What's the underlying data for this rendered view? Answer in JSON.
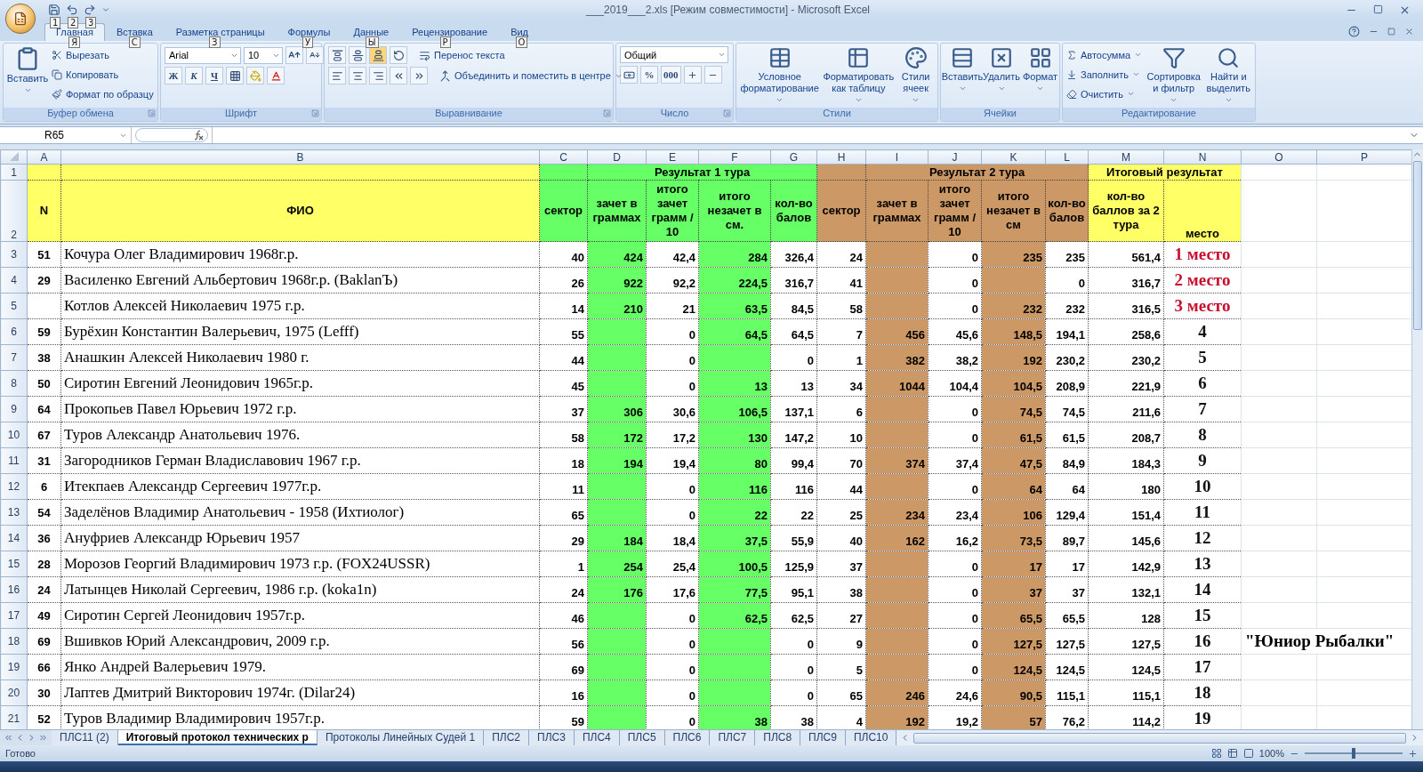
{
  "window": {
    "title": "___2019___2.xls  [Режим совместимости] - Microsoft Excel",
    "quick_access_keytips": [
      "1",
      "2",
      "3"
    ]
  },
  "ribbon": {
    "tabs": [
      {
        "label": "Главная",
        "keytip": "Я",
        "selected": true
      },
      {
        "label": "Вставка",
        "keytip": "С",
        "selected": false
      },
      {
        "label": "Разметка страницы",
        "keytip": "З",
        "selected": false
      },
      {
        "label": "Формулы",
        "keytip": "У",
        "selected": false
      },
      {
        "label": "Данные",
        "keytip": "Ы",
        "selected": false
      },
      {
        "label": "Рецензирование",
        "keytip": "Р",
        "selected": false
      },
      {
        "label": "Вид",
        "keytip": "О",
        "selected": false
      }
    ],
    "clipboard": {
      "title": "Буфер обмена",
      "paste": "Вставить",
      "items": [
        "Вырезать",
        "Копировать",
        "Формат по образцу"
      ]
    },
    "font": {
      "title": "Шрифт",
      "name": "Arial",
      "size": "10",
      "styles": [
        "Ж",
        "К",
        "Ч"
      ]
    },
    "alignment": {
      "title": "Выравнивание",
      "vertical_align": [
        {
          "selected": false
        },
        {
          "selected": false
        },
        {
          "selected": true
        }
      ],
      "wrap": "Перенос текста",
      "merge": "Объединить и поместить в центре"
    },
    "number": {
      "title": "Число",
      "format": "Общий",
      "percent": "%",
      "thousands": "000"
    },
    "styles": {
      "title": "Стили",
      "buttons": [
        "Условное форматирование",
        "Форматировать как таблицу",
        "Стили ячеек"
      ]
    },
    "cells": {
      "title": "Ячейки",
      "buttons": [
        "Вставить",
        "Удалить",
        "Формат"
      ]
    },
    "editing": {
      "title": "Редактирование",
      "items": [
        "Автосумма",
        "Заполнить",
        "Очистить"
      ],
      "buttons": [
        "Сортировка и фильтр",
        "Найти и выделить"
      ]
    }
  },
  "formula_bar": {
    "name_box": "R65"
  },
  "sheet": {
    "column_letters": [
      "A",
      "B",
      "C",
      "D",
      "E",
      "F",
      "G",
      "H",
      "I",
      "J",
      "K",
      "L",
      "M",
      "N",
      "O",
      "P"
    ],
    "groups": [
      {
        "label": "Результат 1 тура",
        "color": "#66ff66"
      },
      {
        "label": "Результат 2 тура",
        "color": "#cc9966"
      },
      {
        "label": "Итоговый результат",
        "color": "#ffff66"
      }
    ],
    "header_rows": [
      "1",
      "2"
    ],
    "headers": [
      "N",
      "ФИО",
      "сектор",
      "зачет в граммах",
      "итого зачет грамм / 10",
      "итого незачет в см.",
      "кол-во балов",
      "сектор",
      "зачет в граммах",
      "итого зачет грамм / 10",
      "итого незачет в см",
      "кол-во балов",
      "кол-во баллов за 2 тура",
      "место"
    ],
    "rows": [
      {
        "row": "3",
        "cells": [
          "51",
          "Кочура Олег Владимирович 1968г.р.",
          "40",
          "424",
          "42,4",
          "284",
          "326,4",
          "24",
          null,
          "0",
          "235",
          "235",
          "561,4",
          "1 место"
        ],
        "prize": true
      },
      {
        "row": "4",
        "cells": [
          "29",
          "Василенко Евгений Альбертович 1968г.р. (BaklanЪ)",
          "26",
          "922",
          "92,2",
          "224,5",
          "316,7",
          "41",
          null,
          "0",
          null,
          "0",
          "316,7",
          "2 место"
        ],
        "prize": true
      },
      {
        "row": "5",
        "cells": [
          null,
          "Котлов Алексей Николаевич 1975 г.р.",
          "14",
          "210",
          "21",
          "63,5",
          "84,5",
          "58",
          null,
          "0",
          "232",
          "232",
          "316,5",
          "3 место"
        ],
        "prize": true
      },
      {
        "row": "6",
        "cells": [
          "59",
          "Бурёхин Константин Валерьевич, 1975 (Lefff)",
          "55",
          null,
          "0",
          "64,5",
          "64,5",
          "7",
          "456",
          "45,6",
          "148,5",
          "194,1",
          "258,6",
          "4"
        ],
        "prize": false
      },
      {
        "row": "7",
        "cells": [
          "38",
          "Анашкин Алексей Николаевич 1980 г.",
          "44",
          null,
          "0",
          null,
          "0",
          "1",
          "382",
          "38,2",
          "192",
          "230,2",
          "230,2",
          "5"
        ],
        "prize": false
      },
      {
        "row": "8",
        "cells": [
          "50",
          "Сиротин Евгений Леонидович 1965г.р.",
          "45",
          null,
          "0",
          "13",
          "13",
          "34",
          "1044",
          "104,4",
          "104,5",
          "208,9",
          "221,9",
          "6"
        ],
        "prize": false
      },
      {
        "row": "9",
        "cells": [
          "64",
          "Прокопьев Павел Юрьевич 1972 г.р.",
          "37",
          "306",
          "30,6",
          "106,5",
          "137,1",
          "6",
          null,
          "0",
          "74,5",
          "74,5",
          "211,6",
          "7"
        ],
        "prize": false
      },
      {
        "row": "10",
        "cells": [
          "67",
          "Туров Александр Анатольевич 1976.",
          "58",
          "172",
          "17,2",
          "130",
          "147,2",
          "10",
          null,
          "0",
          "61,5",
          "61,5",
          "208,7",
          "8"
        ],
        "prize": false
      },
      {
        "row": "11",
        "cells": [
          "31",
          "Загородников Герман Владиславович 1967 г.р.",
          "18",
          "194",
          "19,4",
          "80",
          "99,4",
          "70",
          "374",
          "37,4",
          "47,5",
          "84,9",
          "184,3",
          "9"
        ],
        "prize": false
      },
      {
        "row": "12",
        "cells": [
          "6",
          "Итекпаев Александр Сергеевич 1977г.р.",
          "11",
          null,
          "0",
          "116",
          "116",
          "44",
          null,
          "0",
          "64",
          "64",
          "180",
          "10"
        ],
        "prize": false
      },
      {
        "row": "13",
        "cells": [
          "54",
          "Заделёнов Владимир Анатольевич - 1958 (Ихтиолог)",
          "65",
          null,
          "0",
          "22",
          "22",
          "25",
          "234",
          "23,4",
          "106",
          "129,4",
          "151,4",
          "11"
        ],
        "prize": false
      },
      {
        "row": "14",
        "cells": [
          "36",
          "Ануфриев Александр Юрьевич 1957",
          "29",
          "184",
          "18,4",
          "37,5",
          "55,9",
          "40",
          "162",
          "16,2",
          "73,5",
          "89,7",
          "145,6",
          "12"
        ],
        "prize": false
      },
      {
        "row": "15",
        "cells": [
          "28",
          "Морозов Георгий Владимирович 1973 г.р. (FOX24USSR)",
          "1",
          "254",
          "25,4",
          "100,5",
          "125,9",
          "37",
          null,
          "0",
          "17",
          "17",
          "142,9",
          "13"
        ],
        "prize": false
      },
      {
        "row": "16",
        "cells": [
          "24",
          "Латынцев Николай Сергеевич, 1986 г.р. (koka1n)",
          "24",
          "176",
          "17,6",
          "77,5",
          "95,1",
          "38",
          null,
          "0",
          "37",
          "37",
          "132,1",
          "14"
        ],
        "prize": false
      },
      {
        "row": "17",
        "cells": [
          "49",
          "Сиротин Сергей Леонидович 1957г.р.",
          "46",
          null,
          "0",
          "62,5",
          "62,5",
          "27",
          null,
          "0",
          "65,5",
          "65,5",
          "128",
          "15"
        ],
        "prize": false
      },
      {
        "row": "18",
        "cells": [
          "69",
          "Вшивков Юрий Александрович, 2009 г.р.",
          "56",
          null,
          "0",
          null,
          "0",
          "9",
          null,
          "0",
          "127,5",
          "127,5",
          "127,5",
          "16"
        ],
        "prize": false,
        "note": "\"Юниор Рыбалки\""
      },
      {
        "row": "19",
        "cells": [
          "66",
          "Янко Андрей Валерьевич 1979.",
          "69",
          null,
          "0",
          null,
          "0",
          "5",
          null,
          "0",
          "124,5",
          "124,5",
          "124,5",
          "17"
        ],
        "prize": false
      },
      {
        "row": "20",
        "cells": [
          "30",
          "Лаптев Дмитрий Викторович 1974г. (Dilar24)",
          "16",
          null,
          "0",
          null,
          "0",
          "65",
          "246",
          "24,6",
          "90,5",
          "115,1",
          "115,1",
          "18"
        ],
        "prize": false
      },
      {
        "row": "21",
        "cells": [
          "52",
          "Туров Владимир Владимирович 1957г.р.",
          "59",
          null,
          "0",
          "38",
          "38",
          "4",
          "192",
          "19,2",
          "57",
          "76,2",
          "114,2",
          "19"
        ],
        "prize": false
      }
    ]
  },
  "sheet_tabs": [
    {
      "label": "ПЛС11 (2)",
      "selected": false
    },
    {
      "label": "Итоговый протокол технических р",
      "selected": true
    },
    {
      "label": "Протоколы Линейных Судей 1",
      "selected": false
    },
    {
      "label": "ПЛС2",
      "selected": false
    },
    {
      "label": "ПЛС3",
      "selected": false
    },
    {
      "label": "ПЛС4",
      "selected": false
    },
    {
      "label": "ПЛС5",
      "selected": false
    },
    {
      "label": "ПЛС6",
      "selected": false
    },
    {
      "label": "ПЛС7",
      "selected": false
    },
    {
      "label": "ПЛС8",
      "selected": false
    },
    {
      "label": "ПЛС9",
      "selected": false
    },
    {
      "label": "ПЛС10",
      "selected": false
    }
  ],
  "status_bar": {
    "status": "Готово",
    "zoom": "100%",
    "zoom_slider": {
      "level": 0.5
    }
  }
}
